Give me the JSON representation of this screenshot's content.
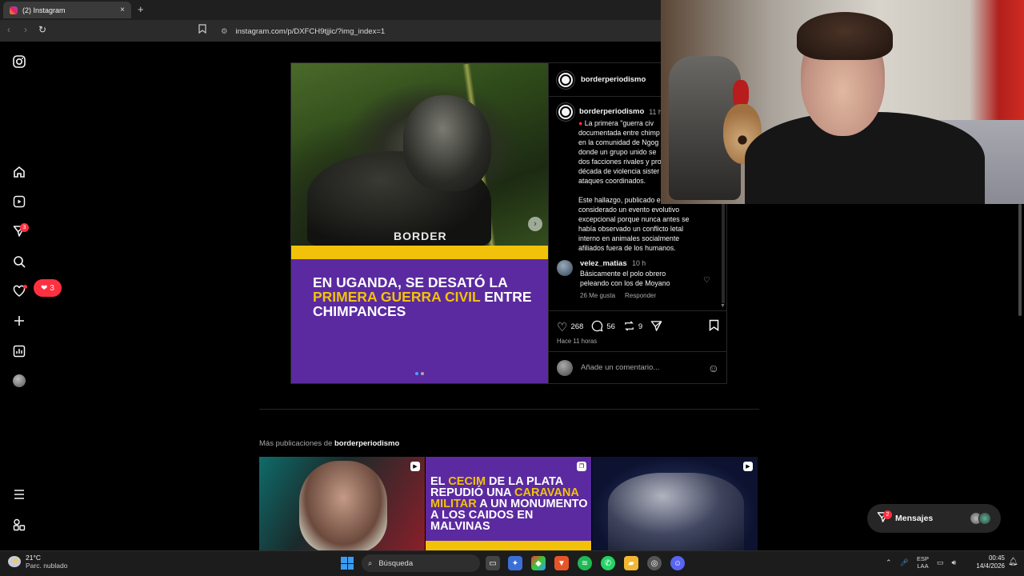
{
  "browser": {
    "tab_title": "(2) Instagram",
    "tab_close": "×",
    "new_tab": "+",
    "url": "instagram.com/p/DXFCH9tjjic/?img_index=1"
  },
  "rail": {
    "notifications_badge": "3",
    "likes_count": "3"
  },
  "post": {
    "image_logo": "BORDER",
    "headline_parts": [
      "EN UGANDA, SE DESATÓ LA ",
      "PRIMERA GUERRA CIVIL",
      " ENTRE CHIMPANCES"
    ],
    "author": "borderperiodismo",
    "caption_time": "11 h",
    "caption_lines": "La primera \"guerra civ\ndocumentada entre chimp\nen la comunidad de Ngog\ndonde un grupo unido se\ndos facciones rivales y pro\ndécada de violencia sister\nataques coordinados.",
    "caption_lines2": "Este hallazgo, publicado e\nconsiderado un evento evolutivo\nexcepcional porque nunca antes se\nhabía observado un conflicto letal\ninterno en animales socialmente\nafiliados fuera de los humanos.",
    "comment": {
      "user": "velez_matias",
      "time": "10 h",
      "text": "Básicamente el polo obrero peleando con los de Moyano",
      "likes": "26 Me gusta",
      "reply": "Responder"
    },
    "likes": "268",
    "comments": "56",
    "reposts": "9",
    "time_ago": "Hace 11 horas",
    "add_comment_placeholder": "Añade un comentario..."
  },
  "more": {
    "label_prefix": "Más publicaciones de ",
    "label_user": "borderperiodismo",
    "thumb2_parts": [
      "EL ",
      "CECIM",
      " DE LA PLATA REPUDIÓ UNA ",
      "CARAVANA MILITAR",
      " A UN MONUMENTO A LOS CAIDOS EN MALVINAS"
    ]
  },
  "messages": {
    "label": "Mensajes",
    "badge": "2"
  },
  "taskbar": {
    "temp": "21°C",
    "condition": "Parc. nublado",
    "search": "Búsqueda",
    "lang_top": "ESP",
    "lang_bottom": "LAA",
    "time": "00:45",
    "date": "14/4/2026"
  },
  "colors": {
    "accent_red": "#ff3040",
    "brand_purple": "#5b2aa0",
    "brand_yellow": "#f2c20a"
  }
}
